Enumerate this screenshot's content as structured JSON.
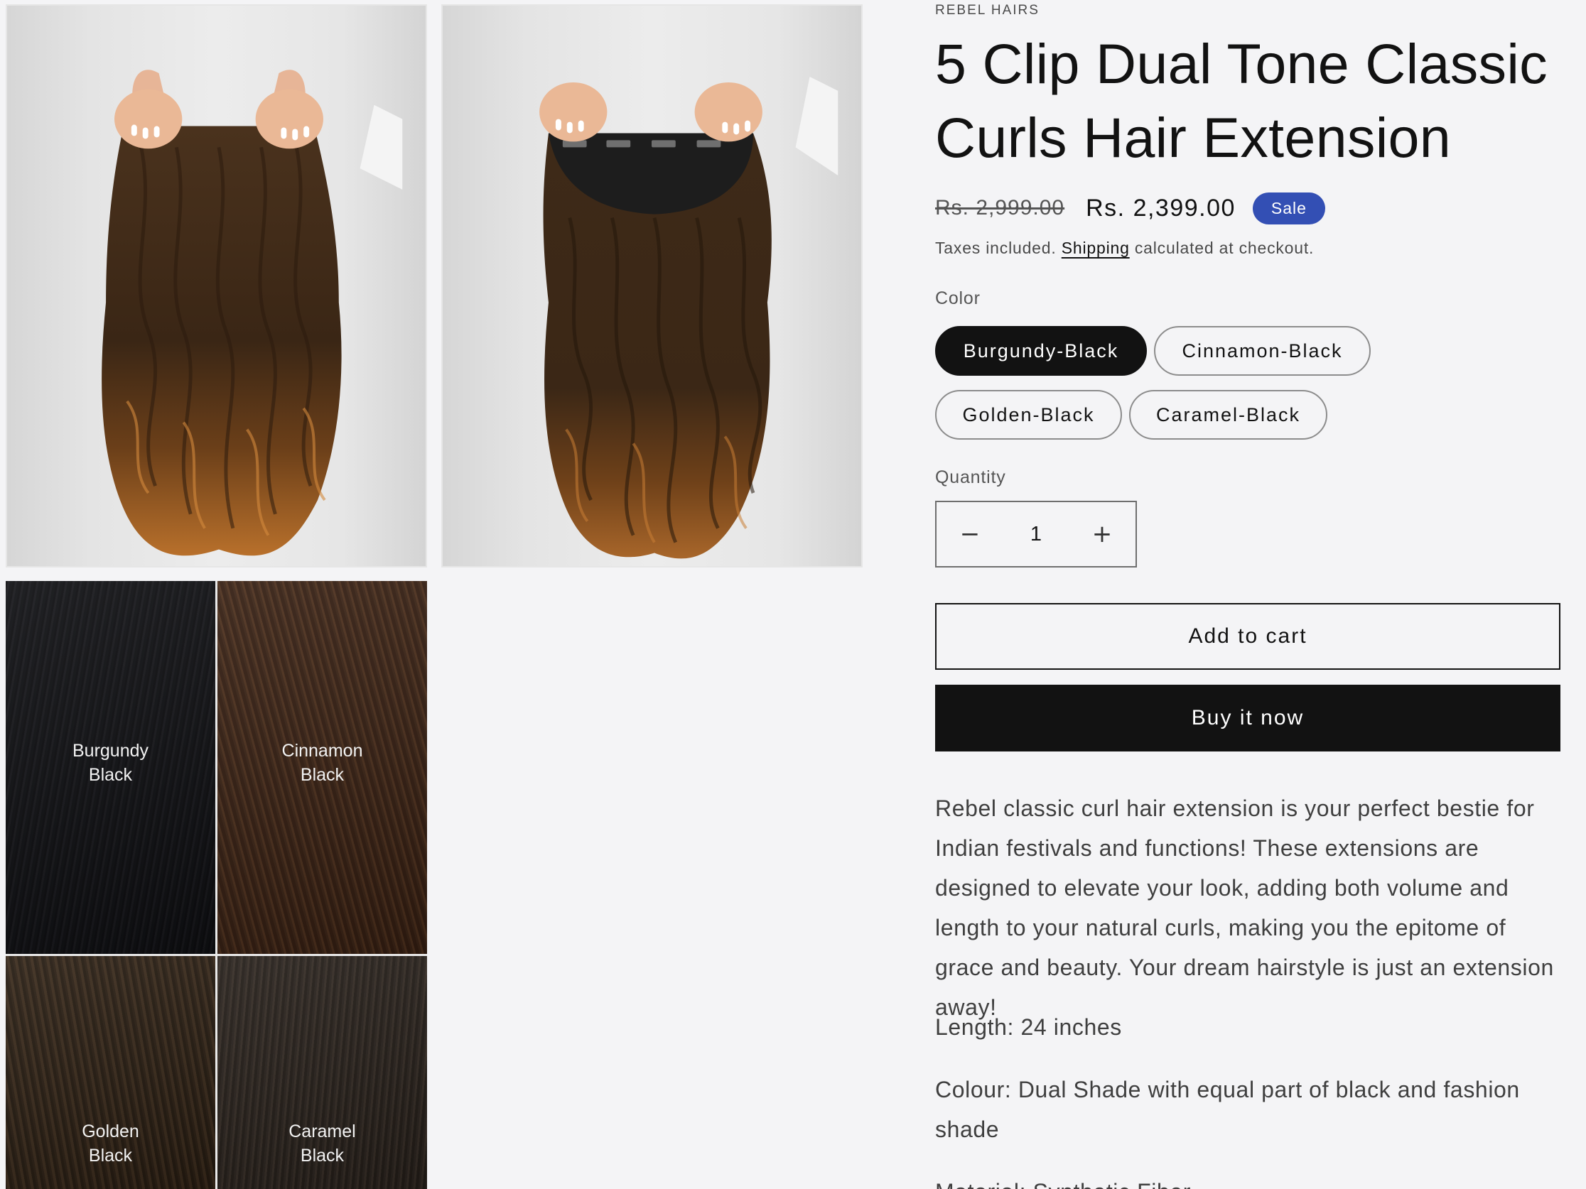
{
  "gallery": {
    "swatches": [
      {
        "label": "Burgundy\nBlack"
      },
      {
        "label": "Cinnamon\nBlack"
      },
      {
        "label": "Golden\nBlack"
      },
      {
        "label": "Caramel\nBlack"
      }
    ]
  },
  "product": {
    "vendor": "REBEL HAIRS",
    "title": "5 Clip Dual Tone Classic Curls Hair Extension",
    "price_regular": "Rs. 2,999.00",
    "price_sale": "Rs. 2,399.00",
    "badge": "Sale",
    "badge_color": "#334fb4",
    "tax_prefix": "Taxes included.",
    "shipping_link": "Shipping",
    "tax_suffix": "calculated at checkout.",
    "color_label": "Color",
    "colors": [
      {
        "label": "Burgundy-Black",
        "selected": true
      },
      {
        "label": "Cinnamon-Black",
        "selected": false
      },
      {
        "label": "Golden-Black",
        "selected": false
      },
      {
        "label": "Caramel-Black",
        "selected": false
      }
    ],
    "quantity_label": "Quantity",
    "quantity_value": "1",
    "add_to_cart": "Add to cart",
    "buy_now": "Buy it now",
    "description": "Rebel classic curl hair extension is your perfect bestie for Indian festivals and functions! These extensions are designed to elevate your look, adding both volume and length to your natural curls, making you the epitome of grace and beauty. Your dream hairstyle is just an extension away!",
    "length": "Length: 24 inches",
    "colour_spec": "Colour: Dual Shade with equal part of black and fashion shade",
    "material": "Material: Synthetic Fiber"
  }
}
